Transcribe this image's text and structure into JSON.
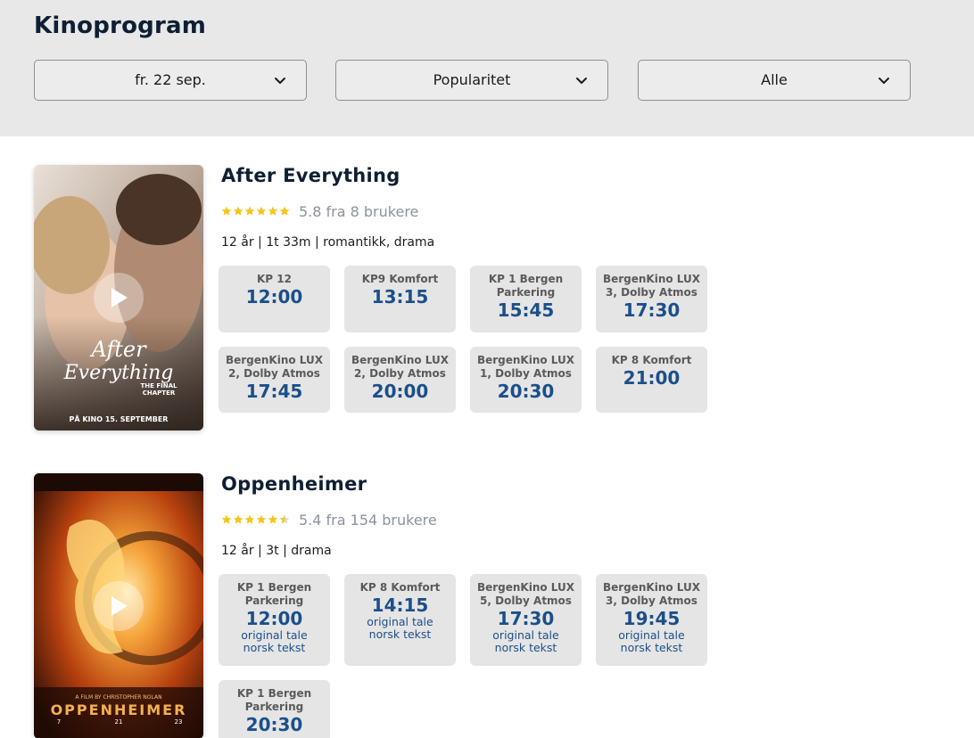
{
  "header": {
    "title": "Kinoprogram",
    "filters": [
      {
        "label": "fr. 22 sep."
      },
      {
        "label": "Popularitet"
      },
      {
        "label": "Alle"
      }
    ]
  },
  "colors": {
    "header_bg": "#e8e8e8",
    "time": "#1b4f8a",
    "star": "#f5c518",
    "tile_bg": "#e5e5e5"
  },
  "movies": [
    {
      "title": "After Everything",
      "rating_text": "5.8 fra 8 brukere",
      "rating_stars": 6,
      "rating_max": 6,
      "meta": "12 år | 1t 33m | romantikk, drama",
      "poster": {
        "line1": "After",
        "line2": "Everything",
        "sub1": "THE FINAL",
        "sub2": "CHAPTER",
        "release": "PÅ KINO 15. SEPTEMBER"
      },
      "showtimes": [
        {
          "venue": "KP 12",
          "time": "12:00"
        },
        {
          "venue": "KP9 Komfort",
          "time": "13:15"
        },
        {
          "venue": "KP 1 Bergen Parkering",
          "time": "15:45"
        },
        {
          "venue": "BergenKino LUX 3, Dolby Atmos",
          "time": "17:30"
        },
        {
          "venue": "BergenKino LUX 2, Dolby Atmos",
          "time": "17:45"
        },
        {
          "venue": "BergenKino LUX 2, Dolby Atmos",
          "time": "20:00"
        },
        {
          "venue": "BergenKino LUX 1, Dolby Atmos",
          "time": "20:30"
        },
        {
          "venue": "KP 8 Komfort",
          "time": "21:00"
        }
      ]
    },
    {
      "title": "Oppenheimer",
      "rating_text": "5.4 fra 154 brukere",
      "rating_stars": 5.5,
      "rating_max": 6,
      "meta": "12 år | 3t | drama",
      "poster": {
        "line1": "OPPENHEIMER",
        "credit": "A FILM BY CHRISTOPHER NOLAN",
        "d1": "7",
        "d2": "21",
        "d3": "23"
      },
      "showtimes": [
        {
          "venue": "KP 1 Bergen Parkering",
          "time": "12:00",
          "lang1": "original tale",
          "lang2": "norsk tekst"
        },
        {
          "venue": "KP 8 Komfort",
          "time": "14:15",
          "lang1": "original tale",
          "lang2": "norsk tekst"
        },
        {
          "venue": "BergenKino LUX 5, Dolby Atmos",
          "time": "17:30",
          "lang1": "original tale",
          "lang2": "norsk tekst"
        },
        {
          "venue": "BergenKino LUX 3, Dolby Atmos",
          "time": "19:45",
          "lang1": "original tale",
          "lang2": "norsk tekst"
        },
        {
          "venue": "KP 1 Bergen Parkering",
          "time": "20:30"
        }
      ]
    }
  ]
}
